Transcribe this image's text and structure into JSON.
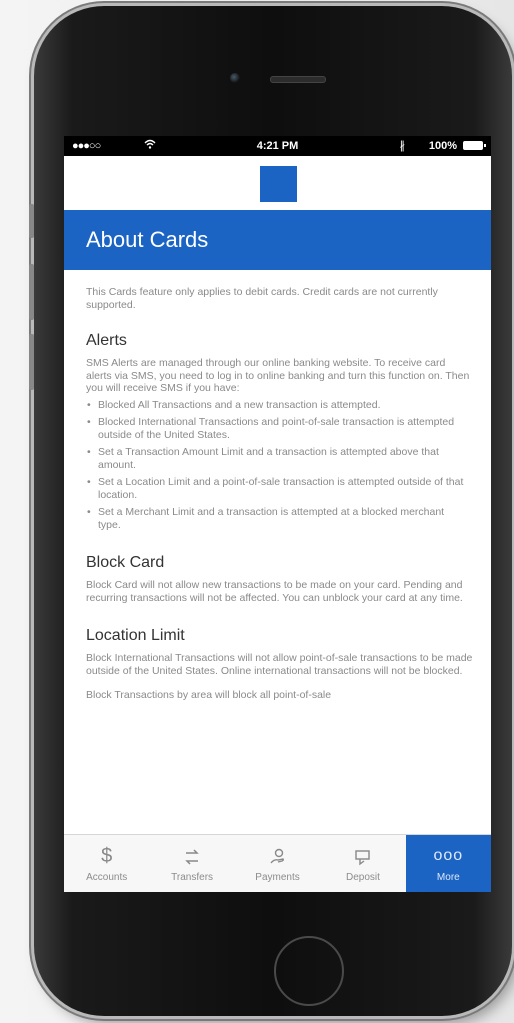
{
  "status_bar": {
    "signal": "●●●○○",
    "wifi_icon": "wifi-icon",
    "time": "4:21 PM",
    "bluetooth": "∦",
    "battery": "100%"
  },
  "brand": {
    "logo_color": "#1c64c4"
  },
  "header": {
    "title": "About Cards"
  },
  "content": {
    "intro": "This Cards feature only applies to debit cards. Credit cards are not currently supported.",
    "sections": [
      {
        "heading": "Alerts",
        "body": "SMS Alerts are managed through our online banking website. To receive card alerts via SMS, you need to log in to online banking and turn this function on. Then you will receive SMS if you have:",
        "bullets": [
          "Blocked All Transactions and a new transaction is attempted.",
          "Blocked International Transactions and point-of-sale transaction is attempted outside of the United States.",
          "Set a Transaction Amount Limit and a transaction is attempted above that amount.",
          "Set a Location Limit and a point-of-sale transaction is attempted outside of that location.",
          "Set a Merchant Limit and a transaction is attempted at a blocked merchant type."
        ]
      },
      {
        "heading": "Block Card",
        "body": "Block Card will not allow new transactions to be made on your card. Pending and recurring transactions will not be affected. You can unblock your card at any time."
      },
      {
        "heading": "Location Limit",
        "body": "Block International Transactions will not allow point-of-sale transactions to be made outside of the United States. Online international transactions will not be blocked.",
        "tail": "Block Transactions by area will block all point-of-sale"
      }
    ]
  },
  "tab_bar": {
    "active_color": "#1c64c4",
    "tabs": [
      {
        "label": "Accounts",
        "icon": "dollar-icon",
        "glyph": "$"
      },
      {
        "label": "Transfers",
        "icon": "transfer-icon",
        "glyph": ""
      },
      {
        "label": "Payments",
        "icon": "payments-icon",
        "glyph": ""
      },
      {
        "label": "Deposit",
        "icon": "deposit-icon",
        "glyph": ""
      },
      {
        "label": "More",
        "icon": "more-icon",
        "glyph": "ooo",
        "active": true
      }
    ]
  }
}
